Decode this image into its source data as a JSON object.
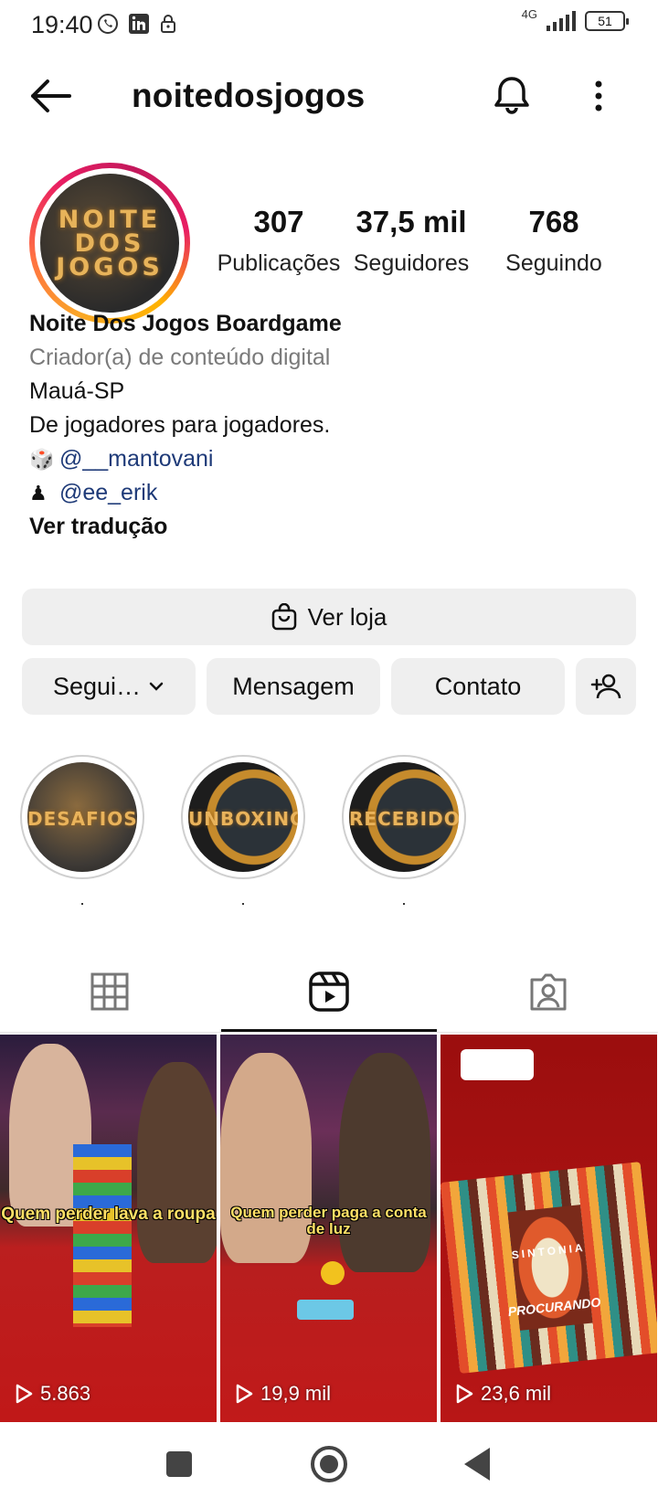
{
  "status_bar": {
    "time": "19:40",
    "network": "4G",
    "battery": "51"
  },
  "header": {
    "username": "noitedosjogos"
  },
  "profile": {
    "avatar_text": "NOITE\nDOS\nJOGOS",
    "stats": [
      {
        "value": "307",
        "label": "Publicações"
      },
      {
        "value": "37,5 mil",
        "label": "Seguidores"
      },
      {
        "value": "768",
        "label": "Seguindo"
      }
    ],
    "bio": {
      "name": "Noite Dos Jogos Boardgame",
      "category": "Criador(a) de conteúdo digital",
      "location": "Mauá-SP",
      "tagline": "De jogadores para jogadores.",
      "link1_emoji": "🎲",
      "link1": "@__mantovani",
      "link2_emoji": "♟",
      "link2": "@ee_erik",
      "translate": "Ver tradução"
    }
  },
  "buttons": {
    "shop": "Ver loja",
    "follow": "Segui…",
    "message": "Mensagem",
    "contact": "Contato"
  },
  "highlights": [
    {
      "title": "DESAFIOS",
      "label": "."
    },
    {
      "title": "UNBOXING",
      "label": "."
    },
    {
      "title": "RECEBIDOS",
      "label": "."
    }
  ],
  "reels": [
    {
      "caption": "Quem perder lava a roupa",
      "views": "5.863"
    },
    {
      "caption": "Quem perder paga a conta de luz",
      "views": "19,9 mil"
    },
    {
      "caption": "SINTONIA",
      "subtitle": "PROCURANDO",
      "views": "23,6 mil"
    }
  ],
  "colors": {
    "link": "#1e3a78",
    "button_bg": "#efefef",
    "ring_gradient": [
      "#f9a825",
      "#e91e63"
    ]
  }
}
